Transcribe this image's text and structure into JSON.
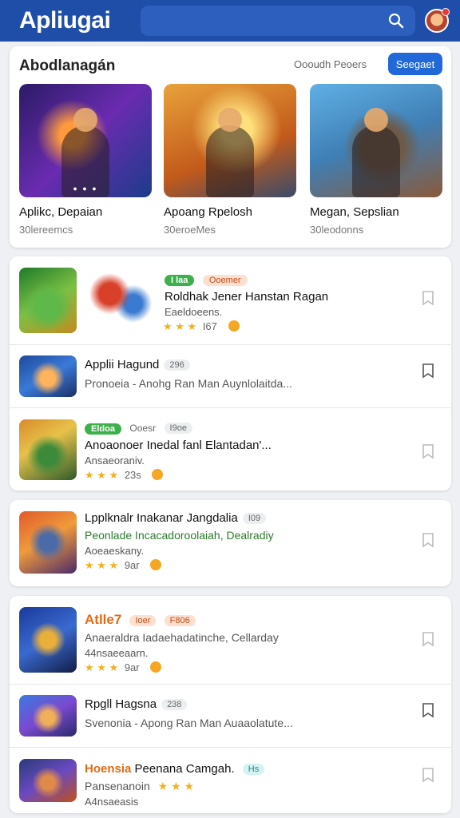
{
  "header": {
    "app_title": "Apliugai"
  },
  "featured": {
    "title": "Abodlanagán",
    "see_all": "Oooudh Peoers",
    "button": "Seegaet",
    "items": [
      {
        "name": "Aplikc, Depaian",
        "meta": "30lereemcs"
      },
      {
        "name": "Apoang Rpelosh",
        "meta": "30eroeMes"
      },
      {
        "name": "Megan, Sepslian",
        "meta": "30leodonns"
      }
    ]
  },
  "list1": {
    "rows": [
      {
        "chip1": "I laa",
        "chip2": "Ooemer",
        "title": "Roldhak Jener Hanstan Ragan",
        "sub": "Eaeldoeens.",
        "stars": "★ ★ ★",
        "count": "I67"
      },
      {
        "title": "Applii Hagund",
        "badge": "296",
        "sub": "Pronoeia - Anohg Ran Man Auynlolaitda..."
      },
      {
        "chip1": "Eldoa",
        "chip2": "Ooesr",
        "chip3": "I9oe",
        "title": "Anoaonoer Inedal fanl Elantadan'...",
        "sub": "Ansaeoraniv.",
        "stars": "★ ★ ★",
        "count": "23s"
      }
    ]
  },
  "list2": {
    "title": "Lpplknalr Inakanar Jangdalia",
    "badge": "I09",
    "sub": "Peonlade Incacadoroolaiah, Dealradiy",
    "sub2": "Aoeaeskany.",
    "stars": "★ ★ ★",
    "count": "9ar"
  },
  "list3": {
    "rows": [
      {
        "title": "Atlle7",
        "chip1": "Ioer",
        "chip2": "F806",
        "sub": "Anaeraldra Iadaehadatinche, Cellarday",
        "sub2": "44nsaeeaarn.",
        "stars": "★ ★ ★",
        "count": "9ar"
      },
      {
        "title": "Rpgll Hagsna",
        "badge": "238",
        "sub": "Svenonia - Apong Ran Man Auaaolatute..."
      },
      {
        "title": "Hoensia",
        "title2": "Peenana Camgah.",
        "badge": "Hs",
        "sub": "Pansenanoin",
        "sub2": "A4nsaeasis"
      }
    ]
  },
  "colors": {
    "header_bg": "#1f4ea8",
    "accent": "#2168d8",
    "star": "#f2b01e"
  }
}
